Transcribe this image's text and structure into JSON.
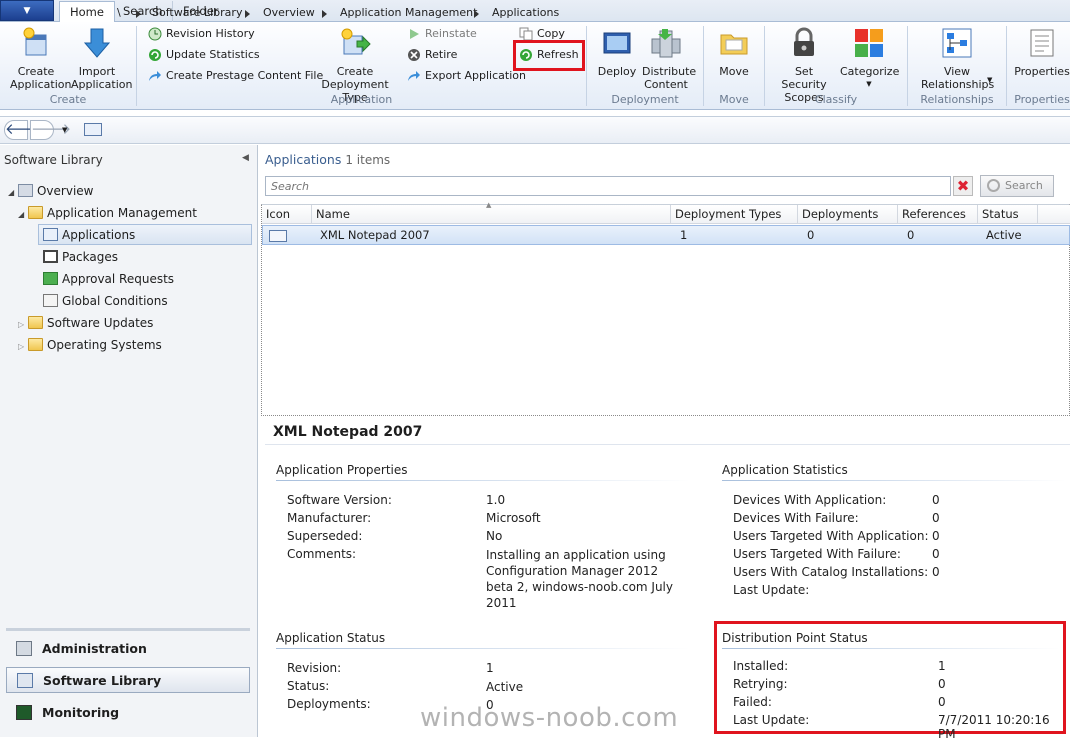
{
  "tabs": [
    {
      "label": "Home"
    },
    {
      "label": "Search"
    },
    {
      "label": "Folder"
    }
  ],
  "ribbon": {
    "create": {
      "create_application": "Create Application",
      "import_application": "Import Application",
      "group": "Create"
    },
    "application": {
      "revision_history": "Revision History",
      "update_statistics": "Update Statistics",
      "create_prestage": "Create Prestage Content File",
      "create_deployment_type": "Create Deployment Type",
      "reinstate": "Reinstate",
      "retire": "Retire",
      "export_application": "Export Application",
      "copy": "Copy",
      "refresh": "Refresh",
      "group": "Application"
    },
    "deployment": {
      "deploy": "Deploy",
      "distribute_content": "Distribute Content",
      "group": "Deployment"
    },
    "move": {
      "move": "Move",
      "group": "Move"
    },
    "classify": {
      "set_security_scopes": "Set Security Scopes",
      "categorize": "Categorize",
      "group": "Classify"
    },
    "relationships": {
      "view_relationships": "View Relationships",
      "group": "Relationships"
    },
    "properties": {
      "properties": "Properties",
      "group": "Properties"
    }
  },
  "breadcrumb": [
    "\\",
    "Software Library",
    "Overview",
    "Application Management",
    "Applications"
  ],
  "leftpane": {
    "title": "Software Library",
    "tree": {
      "overview": "Overview",
      "app_mgmt": "Application Management",
      "applications": "Applications",
      "packages": "Packages",
      "approval_requests": "Approval Requests",
      "global_conditions": "Global Conditions",
      "software_updates": "Software Updates",
      "operating_systems": "Operating Systems"
    },
    "workspaces": {
      "administration": "Administration",
      "software_library": "Software Library",
      "monitoring": "Monitoring"
    }
  },
  "list": {
    "title": "Applications",
    "count": "1 items",
    "search_placeholder": "Search",
    "search_button": "Search",
    "columns": [
      "Icon",
      "Name",
      "Deployment Types",
      "Deployments",
      "References",
      "Status"
    ],
    "rows": [
      {
        "name": "XML Notepad 2007",
        "deployment_types": "1",
        "deployments": "0",
        "references": "0",
        "status": "Active"
      }
    ]
  },
  "details": {
    "title": "XML Notepad 2007",
    "app_properties": {
      "title": "Application Properties",
      "labels": [
        "Software Version:",
        "Manufacturer:",
        "Superseded:",
        "Comments:"
      ],
      "values": [
        "1.0",
        "Microsoft",
        "No",
        "Installing an application using Configuration Manager 2012 beta 2, windows-noob.com July 2011"
      ]
    },
    "app_statistics": {
      "title": "Application Statistics",
      "labels": [
        "Devices With Application:",
        "Devices With Failure:",
        "Users Targeted With Application:",
        "Users Targeted With Failure:",
        "Users With Catalog Installations:",
        "Last Update:"
      ],
      "values": [
        "0",
        "0",
        "0",
        "0",
        "0",
        ""
      ]
    },
    "app_status": {
      "title": "Application Status",
      "labels": [
        "Revision:",
        "Status:",
        "Deployments:"
      ],
      "values": [
        "1",
        "Active",
        "0"
      ]
    },
    "dp_status": {
      "title": "Distribution Point Status",
      "labels": [
        "Installed:",
        "Retrying:",
        "Failed:",
        "Last Update:"
      ],
      "values": [
        "1",
        "0",
        "0",
        "7/7/2011 10:20:16 PM"
      ]
    }
  },
  "watermark": "windows-noob.com",
  "colors": {
    "highlight_box": "#e0141e",
    "selection": "#dde9f8"
  }
}
